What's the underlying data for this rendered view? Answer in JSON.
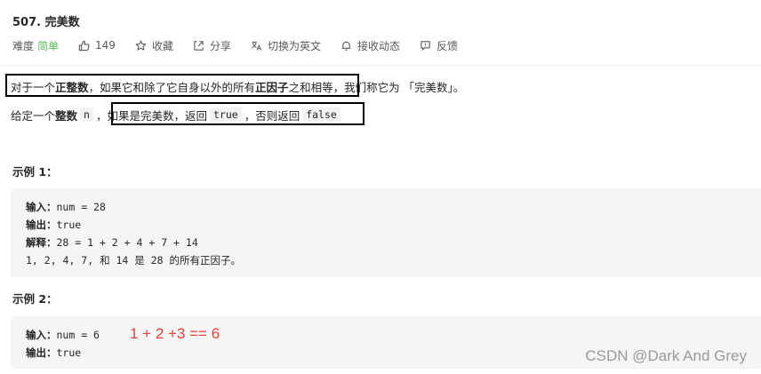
{
  "problem": {
    "title": "507. 完美数"
  },
  "meta": {
    "difficulty_label": "难度",
    "difficulty_value": "简单",
    "difficulty_color": "#5cb85c",
    "likes": "149",
    "favorite": "收藏",
    "share": "分享",
    "switch_lang": "切换为英文",
    "subscribe": "接收动态",
    "feedback": "反馈"
  },
  "description": {
    "line1": {
      "p1": "对于一个 ",
      "b1": "正整数",
      "p2": "，如果它和除了它自身以外的所有 ",
      "b2": "正因子",
      "p3": " 之和相等，我们称它为 「完美数」。"
    },
    "line2": {
      "p1": "给定一个 ",
      "b1": "整数",
      "c1": "n",
      "p2": "，如果是完美数，返回 ",
      "c2": "true",
      "p3": "，否则返回 ",
      "c3": "false"
    }
  },
  "example1": {
    "title": "示例 1：",
    "input_label": "输入：",
    "input_value": "num = 28",
    "output_label": "输出：",
    "output_value": "true",
    "explain_label": "解释：",
    "explain_value": "28 = 1 + 2 + 4 + 7 + 14",
    "explain_line2": "1, 2, 4, 7, 和 14 是 28 的所有正因子。"
  },
  "example2": {
    "title": "示例 2：",
    "input_label": "输入：",
    "input_value": "num = 6",
    "output_label": "输出：",
    "output_value": "true"
  },
  "annotation": {
    "text": "1 + 2 +3 == 6",
    "color": "#e8403a"
  },
  "watermark": "CSDN @Dark And Grey",
  "icons": [
    "thumbs-up-icon",
    "star-icon",
    "share-icon",
    "translate-icon",
    "bell-icon",
    "feedback-icon"
  ]
}
